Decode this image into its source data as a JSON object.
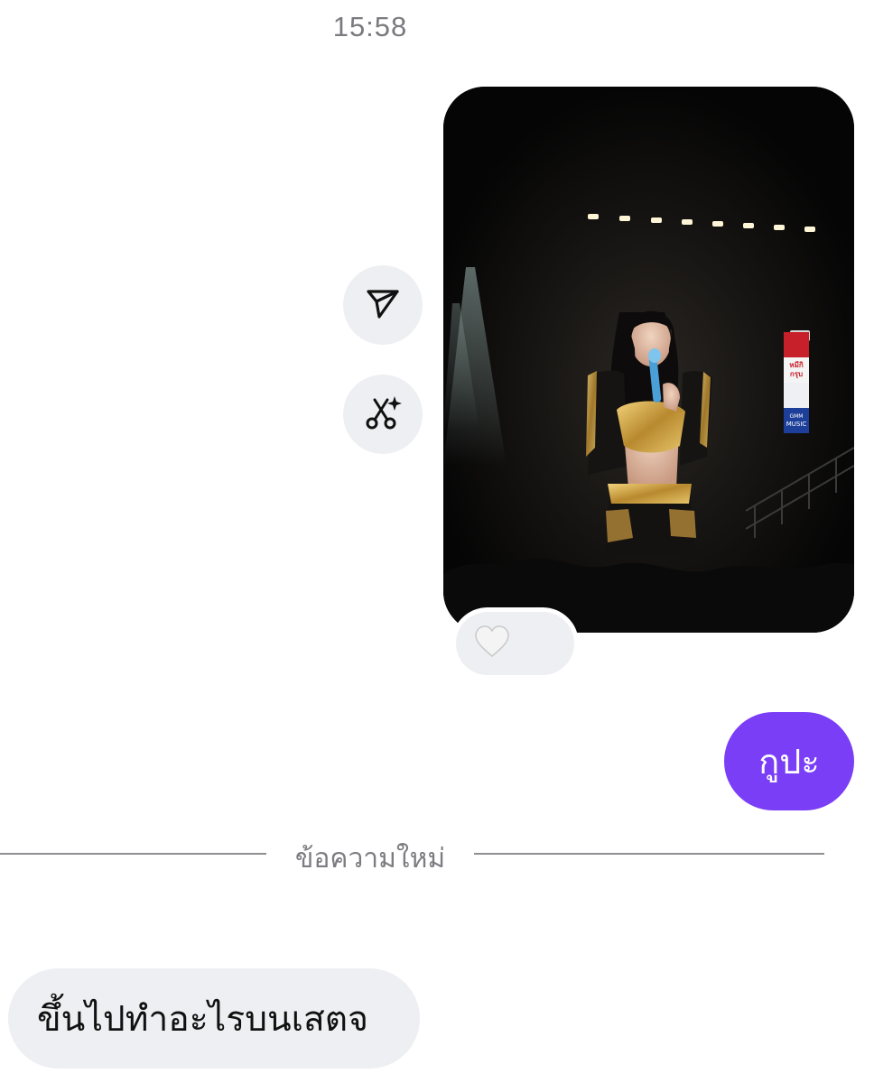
{
  "header": {
    "timestamp": "15:58"
  },
  "thread": {
    "photo_message": {
      "sponsor_banner": [
        "หมีกิ",
        "กรุบ",
        "GMM",
        "MUSIC"
      ],
      "reaction_icon": "white-heart-icon"
    },
    "actions": {
      "share_icon": "send-icon",
      "cutout_icon": "scissors-sparkle-icon"
    },
    "outgoing_message": {
      "text": "กูปะ"
    },
    "divider": {
      "label": "ข้อความใหม่"
    },
    "incoming_message": {
      "text": "ขึ้นไปทำอะไรบนเสตจ"
    }
  },
  "colors": {
    "background": "#ffffff",
    "outgoing_bubble": "#7a3ef6",
    "incoming_bubble": "#eeeff2",
    "secondary_text": "#7a7a7f"
  }
}
